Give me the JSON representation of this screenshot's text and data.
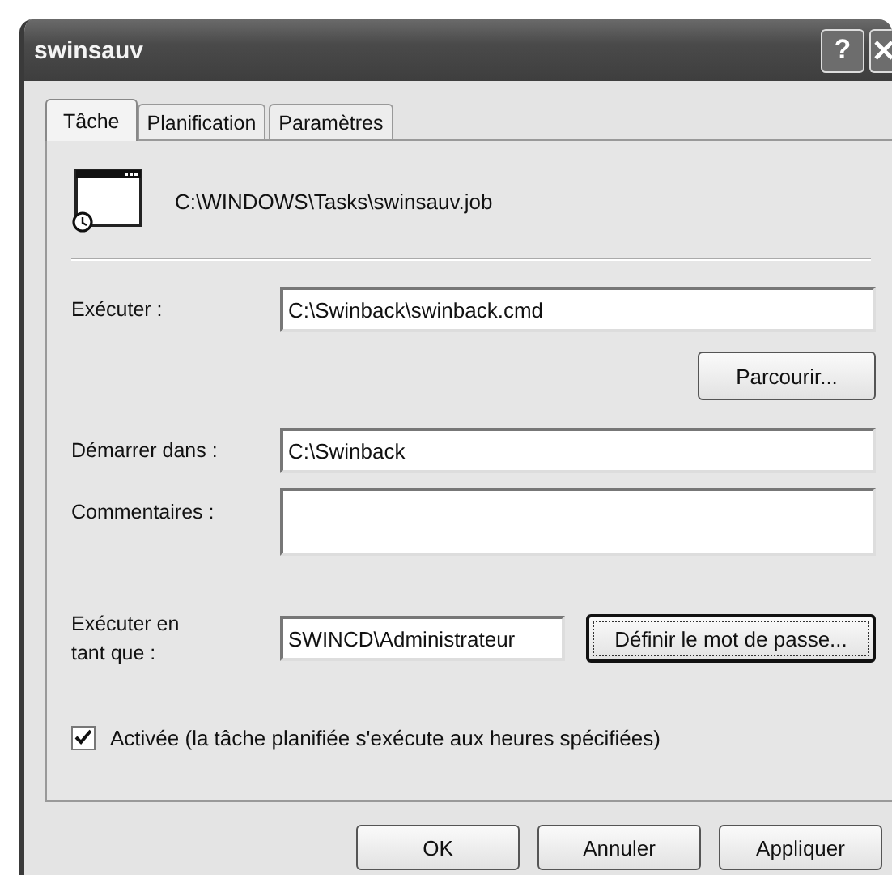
{
  "window": {
    "title": "swinsauv",
    "help": "?"
  },
  "tabs": [
    {
      "label": "Tâche",
      "selected": true
    },
    {
      "label": "Planification",
      "selected": false
    },
    {
      "label": "Paramètres",
      "selected": false
    }
  ],
  "task_path": "C:\\WINDOWS\\Tasks\\swinsauv.job",
  "run": {
    "label": "Exécuter :",
    "value": "C:\\Swinback\\swinback.cmd",
    "button": "Parcourir..."
  },
  "start_in": {
    "label": "Démarrer dans :",
    "value": "C:\\Swinback"
  },
  "comments": {
    "label": "Commentaires :"
  },
  "run_as": {
    "label": "Exécuter en tant que :",
    "value": "SWINCD\\Administrateur",
    "button": "Définir le mot de passe...",
    "button_focused": true
  },
  "enabled": {
    "label": "Activée (la tâche planifiée s'exécute aux heures spécifiées)",
    "checked": true
  },
  "buttons": [
    "OK",
    "Annuler",
    "Appliquer"
  ]
}
